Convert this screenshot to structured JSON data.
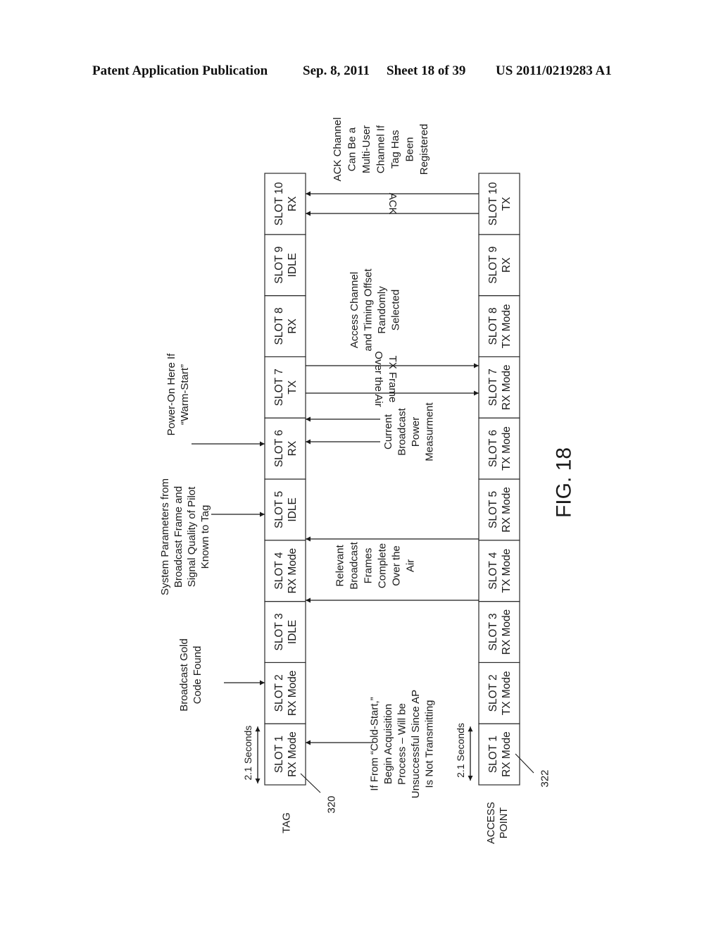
{
  "header": {
    "publication": "Patent Application Publication",
    "date": "Sep. 8, 2011",
    "sheet": "Sheet 18 of 39",
    "number": "US 2011/0219283 A1"
  },
  "figure": {
    "label": "FIG. 18",
    "tag": {
      "name": "TAG",
      "ref": "320",
      "slots": [
        [
          "SLOT 1",
          "RX Mode"
        ],
        [
          "SLOT 2",
          "RX Mode"
        ],
        [
          "SLOT 3",
          "IDLE"
        ],
        [
          "SLOT 4",
          "RX Mode"
        ],
        [
          "SLOT 5",
          "IDLE"
        ],
        [
          "SLOT 6",
          "RX"
        ],
        [
          "SLOT 7",
          "TX"
        ],
        [
          "SLOT 8",
          "RX"
        ],
        [
          "SLOT 9",
          "IDLE"
        ],
        [
          "SLOT 10",
          "RX"
        ]
      ]
    },
    "access_point": {
      "name": [
        "ACCESS",
        "POINT"
      ],
      "ref": "322",
      "slots": [
        [
          "SLOT 1",
          "RX Mode"
        ],
        [
          "SLOT 2",
          "TX Mode"
        ],
        [
          "SLOT 3",
          "RX Mode"
        ],
        [
          "SLOT 4",
          "TX Mode"
        ],
        [
          "SLOT 5",
          "RX Mode"
        ],
        [
          "SLOT 6",
          "TX Mode"
        ],
        [
          "SLOT 7",
          "RX Mode"
        ],
        [
          "SLOT 8",
          "TX Mode"
        ],
        [
          "SLOT 9",
          "RX"
        ],
        [
          "SLOT 10",
          "TX"
        ]
      ]
    },
    "slot_duration_label": "2.1 Seconds",
    "tag_annotations": [
      {
        "slot": 2,
        "lines": [
          "Broadcast Gold",
          "Code Found"
        ]
      },
      {
        "slot": 5,
        "lines": [
          "System Parameters from",
          "Broadcast Frame and",
          "Signal Quality of Pilot",
          "Known to Tag"
        ]
      },
      {
        "slot": 6,
        "lines": [
          "Power-On Here If",
          "“Warm-Start”"
        ]
      }
    ],
    "middle_annotations": {
      "cold_start": [
        "If From “Cold-Start,”",
        "Begin Acquisition",
        "Process – Will be",
        "Unsuccessful Since AP",
        "Is Not Transmitting"
      ],
      "broadcast_frames": [
        "Relevant",
        "Broadcast",
        "Frames",
        "Complete",
        "Over the",
        "Air"
      ],
      "power_measurement": [
        "Current",
        "Broadcast",
        "Power",
        "Measurment"
      ],
      "tx_frame": [
        "TX Frame",
        "Over the Air"
      ],
      "access_channel": [
        "Access Channel",
        "and Timing Offset",
        "Randomly",
        "Selected"
      ],
      "ack_label": "ACK",
      "ack_channel": [
        "ACK Channel",
        "Can Be a",
        "Multi-User",
        "Channel If",
        "Tag Has",
        "Been",
        "Registered"
      ]
    }
  }
}
